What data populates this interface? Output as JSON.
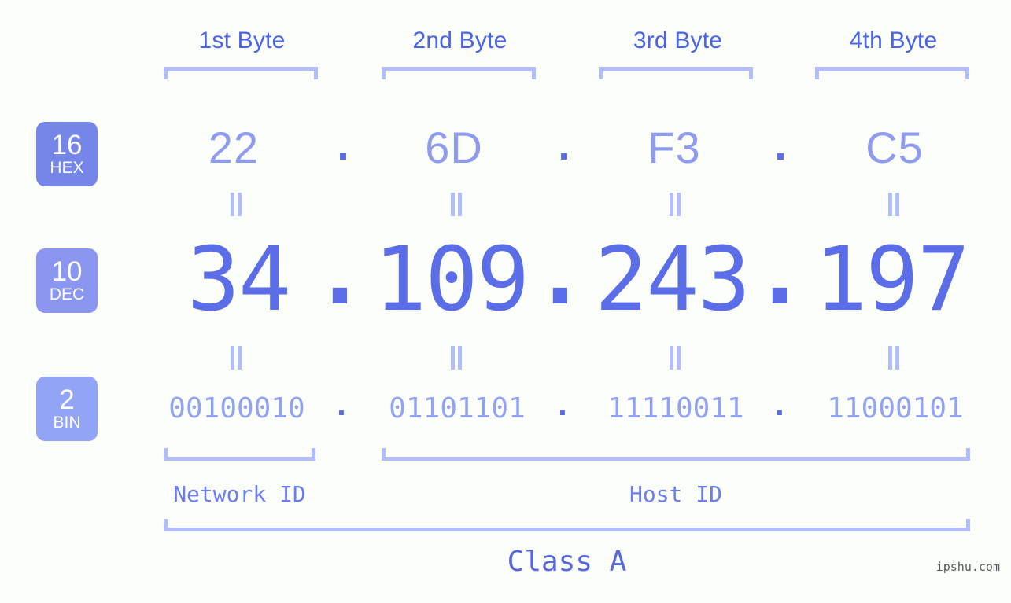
{
  "meta": {
    "ip_decimal": "34.109.243.197",
    "ip_hex": "22.6D.F3.C5",
    "ip_binary": "00100010.01101101.11110011.11000101",
    "watermark": "ipshu.com",
    "background_color": "#fcfefa"
  },
  "colors": {
    "byte_label": "#4963ea",
    "bracket": "#b4bdfb",
    "hex_value": "#8e9bee",
    "dec_value": "#5b6ee8",
    "bin_value": "#93a3f3",
    "dot": "#5b6ee8",
    "badge_hex": "#7586e8",
    "badge_dec": "#8a96f0",
    "badge_bin": "#92a4f5",
    "id_label": "#6b7df0",
    "class_label": "#5568e0",
    "watermark": "#555a63"
  },
  "byte_headers": [
    {
      "label": "1st Byte"
    },
    {
      "label": "2nd Byte"
    },
    {
      "label": "3rd Byte"
    },
    {
      "label": "4th Byte"
    }
  ],
  "bases": [
    {
      "number": "16",
      "name": "HEX"
    },
    {
      "number": "10",
      "name": "DEC"
    },
    {
      "number": "2",
      "name": "BIN"
    }
  ],
  "rows": {
    "hex": {
      "values": [
        "22",
        "6D",
        "F3",
        "C5"
      ],
      "separator": "."
    },
    "dec": {
      "values": [
        "34",
        "109",
        "243",
        "197"
      ],
      "separator": "."
    },
    "bin": {
      "values": [
        "00100010",
        "01101101",
        "11110011",
        "11000101"
      ],
      "separator": "."
    }
  },
  "equals_marker": "=",
  "segments": {
    "network_id": {
      "label": "Network ID"
    },
    "host_id": {
      "label": "Host ID"
    },
    "class": {
      "label": "Class A"
    }
  }
}
